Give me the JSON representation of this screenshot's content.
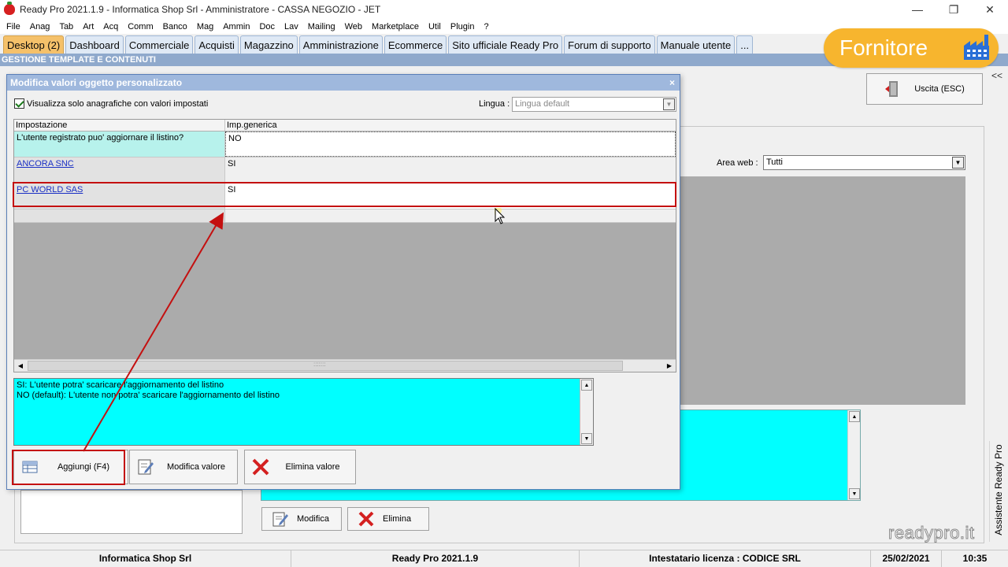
{
  "window": {
    "title": "Ready Pro 2021.1.9 - Informatica Shop Srl - Amministratore - CASSA NEGOZIO - JET",
    "minimize_glyph": "—",
    "maximize_glyph": "❐",
    "close_glyph": "✕"
  },
  "menu": [
    "File",
    "Anag",
    "Tab",
    "Art",
    "Acq",
    "Comm",
    "Banco",
    "Mag",
    "Ammin",
    "Doc",
    "Lav",
    "Mailing",
    "Web",
    "Marketplace",
    "Util",
    "Plugin",
    "?"
  ],
  "tabs": [
    {
      "label": "Desktop (2)",
      "active": true
    },
    {
      "label": "Dashboard"
    },
    {
      "label": "Commerciale"
    },
    {
      "label": "Acquisti"
    },
    {
      "label": "Magazzino"
    },
    {
      "label": "Amministrazione"
    },
    {
      "label": "Ecommerce"
    },
    {
      "label": "Sito ufficiale Ready Pro"
    },
    {
      "label": "Forum di supporto"
    },
    {
      "label": "Manuale utente"
    },
    {
      "label": "..."
    }
  ],
  "section_title": "GESTIONE TEMPLATE E CONTENUTI",
  "badge": {
    "label": "Fornitore",
    "color": "#f7b52e"
  },
  "collapse_glyph": "<<",
  "exit_button": {
    "label": "Uscita (ESC)"
  },
  "area_web": {
    "label": "Area web :",
    "value": "Tutti"
  },
  "side_panel": {
    "label": "Assistente Ready Pro"
  },
  "watermark": "readypro.it",
  "bg_buttons": {
    "modify": "Modifica",
    "delete": "Elimina"
  },
  "dialog": {
    "title": "Modifica valori oggetto personalizzato",
    "close_glyph": "×",
    "filter_checkbox": {
      "label": "Visualizza solo anagrafiche con valori impostati",
      "checked": true
    },
    "language": {
      "label": "Lingua :",
      "value": "Lingua default"
    },
    "grid": {
      "columns": [
        "Impostazione",
        "Imp.generica"
      ],
      "rows": [
        {
          "setting": "L'utente registrato puo' aggiornare il listino?",
          "value": "NO"
        },
        {
          "setting": "ANCORA SNC",
          "value": "SI"
        },
        {
          "setting": "PC WORLD SAS",
          "value": "SI"
        }
      ],
      "scroll_grip": ":::::::"
    },
    "help_lines": [
      "SI: L'utente potra' scaricare l'aggiornamento del listino",
      "NO (default): L'utente non potra' scaricare l'aggiornamento del listino"
    ],
    "buttons": {
      "add": "Aggiungi (F4)",
      "modify": "Modifica valore",
      "delete": "Elimina valore"
    }
  },
  "status_bar": {
    "company": "Informatica Shop Srl",
    "version": "Ready Pro 2021.1.9",
    "license": "Intestatario licenza : CODICE SRL",
    "date": "25/02/2021",
    "time": "10:35"
  },
  "colors": {
    "accent_tab": "#f5c16a",
    "highlight": "#c41010",
    "cyan_panel": "#00ffff",
    "section_bar": "#8fa9cc"
  }
}
